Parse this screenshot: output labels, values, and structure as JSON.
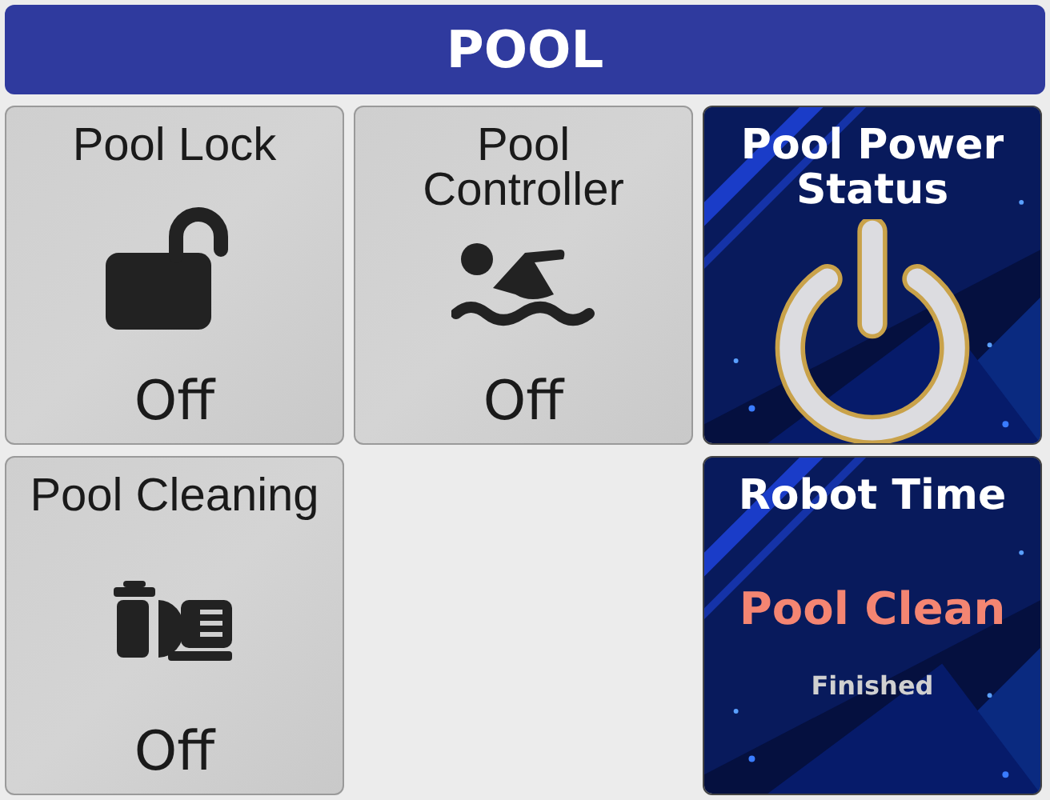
{
  "header": {
    "title": "POOL"
  },
  "tiles": [
    {
      "kind": "switch",
      "title": "Pool Lock",
      "state": "Off"
    },
    {
      "kind": "switch",
      "title": "Pool Controller",
      "state": "Off"
    },
    {
      "kind": "power",
      "title": "Pool Power Status"
    },
    {
      "kind": "switch",
      "title": "Pool Cleaning",
      "state": "Off"
    },
    {
      "kind": "text",
      "title": "Robot Time",
      "value": "Pool Clean",
      "detail": "Finished"
    }
  ]
}
